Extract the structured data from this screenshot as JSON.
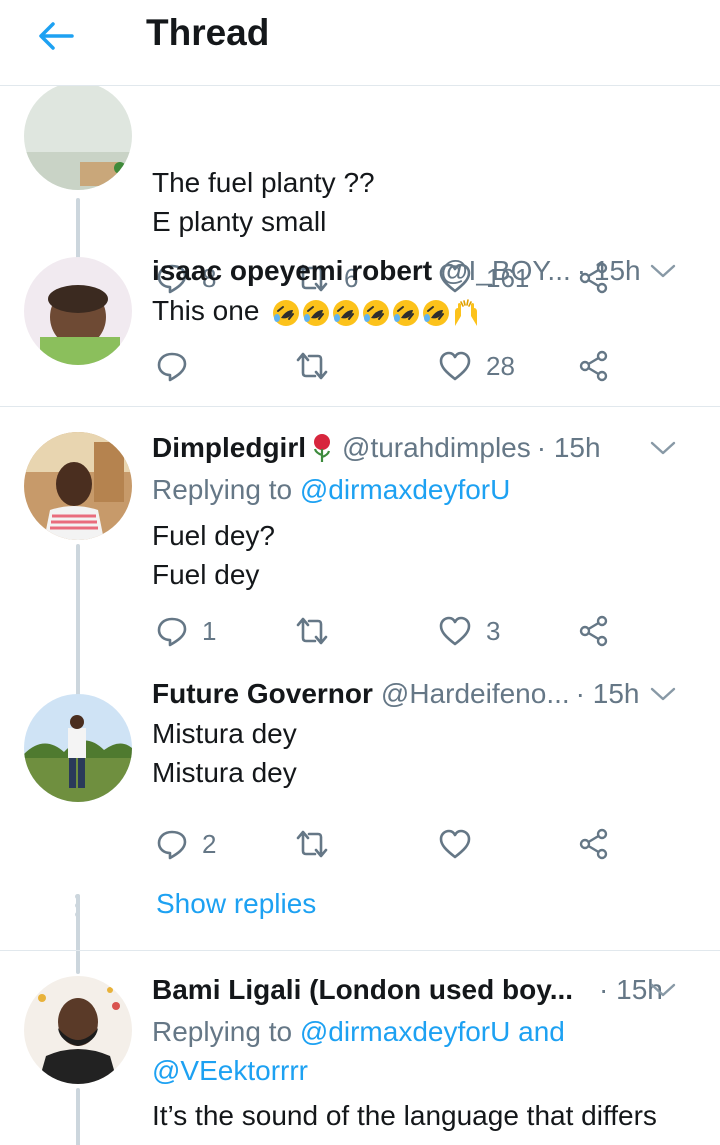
{
  "header": {
    "title": "Thread"
  },
  "colors": {
    "accent": "#1da1f2",
    "secondary_text": "#657786",
    "divider": "#e1e8ed"
  },
  "tweets": [
    {
      "text_line1": "The fuel planty ??",
      "text_line2": "E planty small",
      "replies": "8",
      "retweets": "6",
      "likes": "161"
    },
    {
      "name": "isaac opeyemi robert",
      "handle": "@I_BOY...",
      "time": "· 15h",
      "text": "This one",
      "emojis": [
        "rolling-on-floor-laughing",
        "rolling-on-floor-laughing",
        "rolling-on-floor-laughing",
        "rolling-on-floor-laughing",
        "rolling-on-floor-laughing",
        "rolling-on-floor-laughing",
        "raising-hands"
      ],
      "replies": "",
      "retweets": "",
      "likes": "28"
    },
    {
      "name": "Dimpledgirl",
      "name_emoji": "rose",
      "handle": "@turahdimples",
      "time": "· 15h",
      "replying_prefix": "Replying to",
      "replying_to": "@dirmaxdeyforU",
      "text_line1": "Fuel dey?",
      "text_line2": "Fuel dey",
      "replies": "1",
      "retweets": "",
      "likes": "3"
    },
    {
      "name": "Future Governor",
      "handle": "@Hardeifeno...",
      "time": "· 15h",
      "text_line1": "Mistura dey",
      "text_line2": "Mistura dey",
      "replies": "2",
      "retweets": "",
      "likes": "",
      "show_replies": "Show replies"
    },
    {
      "name": "Bami Ligali (London used boy...",
      "time": "· 15h",
      "replying_prefix": "Replying to",
      "replying_to": "@dirmaxdeyforU",
      "replying_and": "and",
      "replying_to2": "@VEektorrrr",
      "text_line1": "It’s the sound of the language that differs"
    }
  ]
}
